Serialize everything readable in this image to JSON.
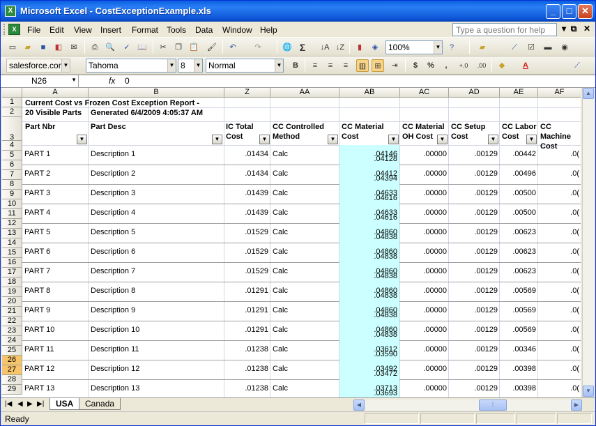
{
  "window": {
    "title": "Microsoft Excel - CostExceptionExample.xls",
    "controls": {
      "min": "_",
      "max": "□",
      "close": "✕"
    }
  },
  "menu": [
    "File",
    "Edit",
    "View",
    "Insert",
    "Format",
    "Tools",
    "Data",
    "Window",
    "Help"
  ],
  "help_box": {
    "placeholder": "Type a question for help"
  },
  "toolbar": {
    "zoom": "100%",
    "addin": "salesforce.com",
    "font": "Tahoma",
    "size": "8",
    "style": "Normal",
    "bold": "B",
    "currency": "$",
    "percent": "%",
    "comma": ",",
    "inc_decimal": "+.0",
    "dec_decimal": ".00"
  },
  "formula_bar": {
    "name": "N26",
    "fx": "fx",
    "value": "0"
  },
  "columns": [
    "A",
    "B",
    "Z",
    "AA",
    "AB",
    "AC",
    "AD",
    "AE",
    "AF"
  ],
  "report": {
    "title": "Current Cost vs Frozen Cost Exception Report -",
    "visible": "20 Visible Parts",
    "generated": "Generated 6/4/2009 4:05:37 AM"
  },
  "headers": {
    "part_nbr": "Part Nbr",
    "part_desc": "Part Desc",
    "ic_total_1": "IC Total",
    "ic_total_2": "Cost",
    "cc_ctrl_1": "CC Controlled",
    "cc_ctrl_2": "Method",
    "cc_mat_1": "CC Material",
    "cc_mat_2": "Cost",
    "cc_matoh_1": "CC Material",
    "cc_matoh_2": "OH Cost",
    "cc_setup_1": "CC Setup",
    "cc_setup_2": "Cost",
    "cc_labor_1": "CC Labor",
    "cc_labor_2": "Cost",
    "cc_mach_1": "CC Machine",
    "cc_mach_2": "Cost"
  },
  "row_numbers": [
    "1",
    "2",
    "3",
    "4",
    "5",
    "6",
    "7",
    "8",
    "9",
    "10",
    "11",
    "12",
    "13",
    "14",
    "15",
    "16",
    "17",
    "18",
    "19",
    "20",
    "21",
    "22",
    "23",
    "24",
    "25",
    "26",
    "27",
    "28",
    "29"
  ],
  "rows": [
    {
      "part": "PART 1",
      "desc": "Description 1",
      "ic": ".01434",
      "method": "Calc",
      "mat1": ".04146",
      "mat2": ".04128",
      "matoh": ".00000",
      "setup": ".00129",
      "labor": ".00442",
      "mach": ".0("
    },
    {
      "part": "PART 2",
      "desc": "Description 2",
      "ic": ".01434",
      "method": "Calc",
      "mat1": ".04412",
      "mat2": ".04394",
      "matoh": ".00000",
      "setup": ".00129",
      "labor": ".00496",
      "mach": ".0("
    },
    {
      "part": "PART 3",
      "desc": "Description 3",
      "ic": ".01439",
      "method": "Calc",
      "mat1": ".04633",
      "mat2": ".04616",
      "matoh": ".00000",
      "setup": ".00129",
      "labor": ".00500",
      "mach": ".0("
    },
    {
      "part": "PART 4",
      "desc": "Description 4",
      "ic": ".01439",
      "method": "Calc",
      "mat1": ".04633",
      "mat2": ".04616",
      "matoh": ".00000",
      "setup": ".00129",
      "labor": ".00500",
      "mach": ".0("
    },
    {
      "part": "PART 5",
      "desc": "Description 5",
      "ic": ".01529",
      "method": "Calc",
      "mat1": ".04860",
      "mat2": ".04838",
      "matoh": ".00000",
      "setup": ".00129",
      "labor": ".00623",
      "mach": ".0("
    },
    {
      "part": "PART 6",
      "desc": "Description 6",
      "ic": ".01529",
      "method": "Calc",
      "mat1": ".04860",
      "mat2": ".04838",
      "matoh": ".00000",
      "setup": ".00129",
      "labor": ".00623",
      "mach": ".0("
    },
    {
      "part": "PART 7",
      "desc": "Description 7",
      "ic": ".01529",
      "method": "Calc",
      "mat1": ".04860",
      "mat2": ".04838",
      "matoh": ".00000",
      "setup": ".00129",
      "labor": ".00623",
      "mach": ".0("
    },
    {
      "part": "PART 8",
      "desc": "Description 8",
      "ic": ".01291",
      "method": "Calc",
      "mat1": ".04860",
      "mat2": ".04838",
      "matoh": ".00000",
      "setup": ".00129",
      "labor": ".00569",
      "mach": ".0("
    },
    {
      "part": "PART 9",
      "desc": "Description 9",
      "ic": ".01291",
      "method": "Calc",
      "mat1": ".04860",
      "mat2": ".04838",
      "matoh": ".00000",
      "setup": ".00129",
      "labor": ".00569",
      "mach": ".0("
    },
    {
      "part": "PART 10",
      "desc": "Description 10",
      "ic": ".01291",
      "method": "Calc",
      "mat1": ".04860",
      "mat2": ".04838",
      "matoh": ".00000",
      "setup": ".00129",
      "labor": ".00569",
      "mach": ".0("
    },
    {
      "part": "PART 11",
      "desc": "Description 11",
      "ic": ".01238",
      "method": "Calc",
      "mat1": ".03612",
      "mat2": ".03590",
      "matoh": ".00000",
      "setup": ".00129",
      "labor": ".00346",
      "mach": ".0("
    },
    {
      "part": "PART 12",
      "desc": "Description 12",
      "ic": ".01238",
      "method": "Calc",
      "mat1": ".03492",
      "mat2": ".03472",
      "matoh": ".00000",
      "setup": ".00129",
      "labor": ".00398",
      "mach": ".0("
    },
    {
      "part": "PART 13",
      "desc": "Description 13",
      "ic": ".01238",
      "method": "Calc",
      "mat1": ".03713",
      "mat2": ".03693",
      "matoh": ".00000",
      "setup": ".00129",
      "labor": ".00398",
      "mach": ".0("
    }
  ],
  "sheets": [
    "USA",
    "Canada"
  ],
  "status": "Ready",
  "colors": {
    "highlight": "#ccffff",
    "selected_row": "#f6c46b"
  }
}
